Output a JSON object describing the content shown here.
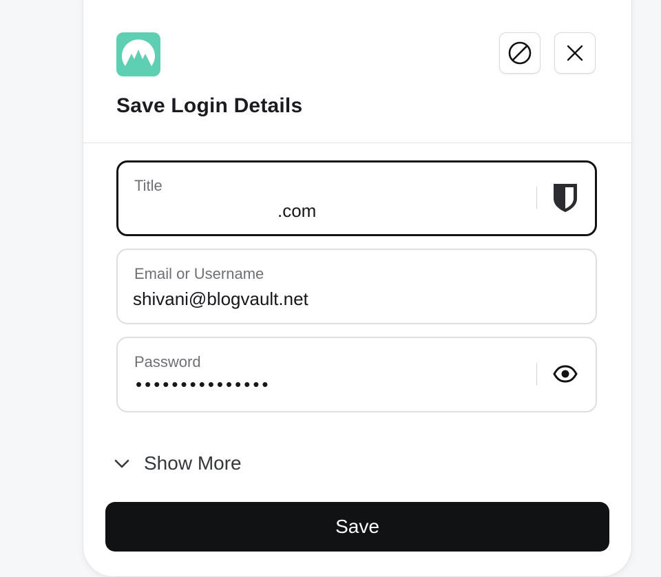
{
  "dialog": {
    "title": "Save Login Details",
    "accent_color": "#5fcfb3"
  },
  "header": {
    "logo_icon": "nordpass-mountain-logo",
    "never_icon": "block-icon",
    "close_icon": "close-icon"
  },
  "fields": {
    "title": {
      "label": "Title",
      "value": ".com",
      "icon": "shield-icon"
    },
    "username": {
      "label": "Email or Username",
      "value": "shivani@blogvault.net"
    },
    "password": {
      "label": "Password",
      "value_masked": "•••••••••••••••",
      "icon": "eye-icon"
    }
  },
  "show_more": {
    "label": "Show More",
    "icon": "chevron-down-icon"
  },
  "actions": {
    "save_label": "Save"
  }
}
